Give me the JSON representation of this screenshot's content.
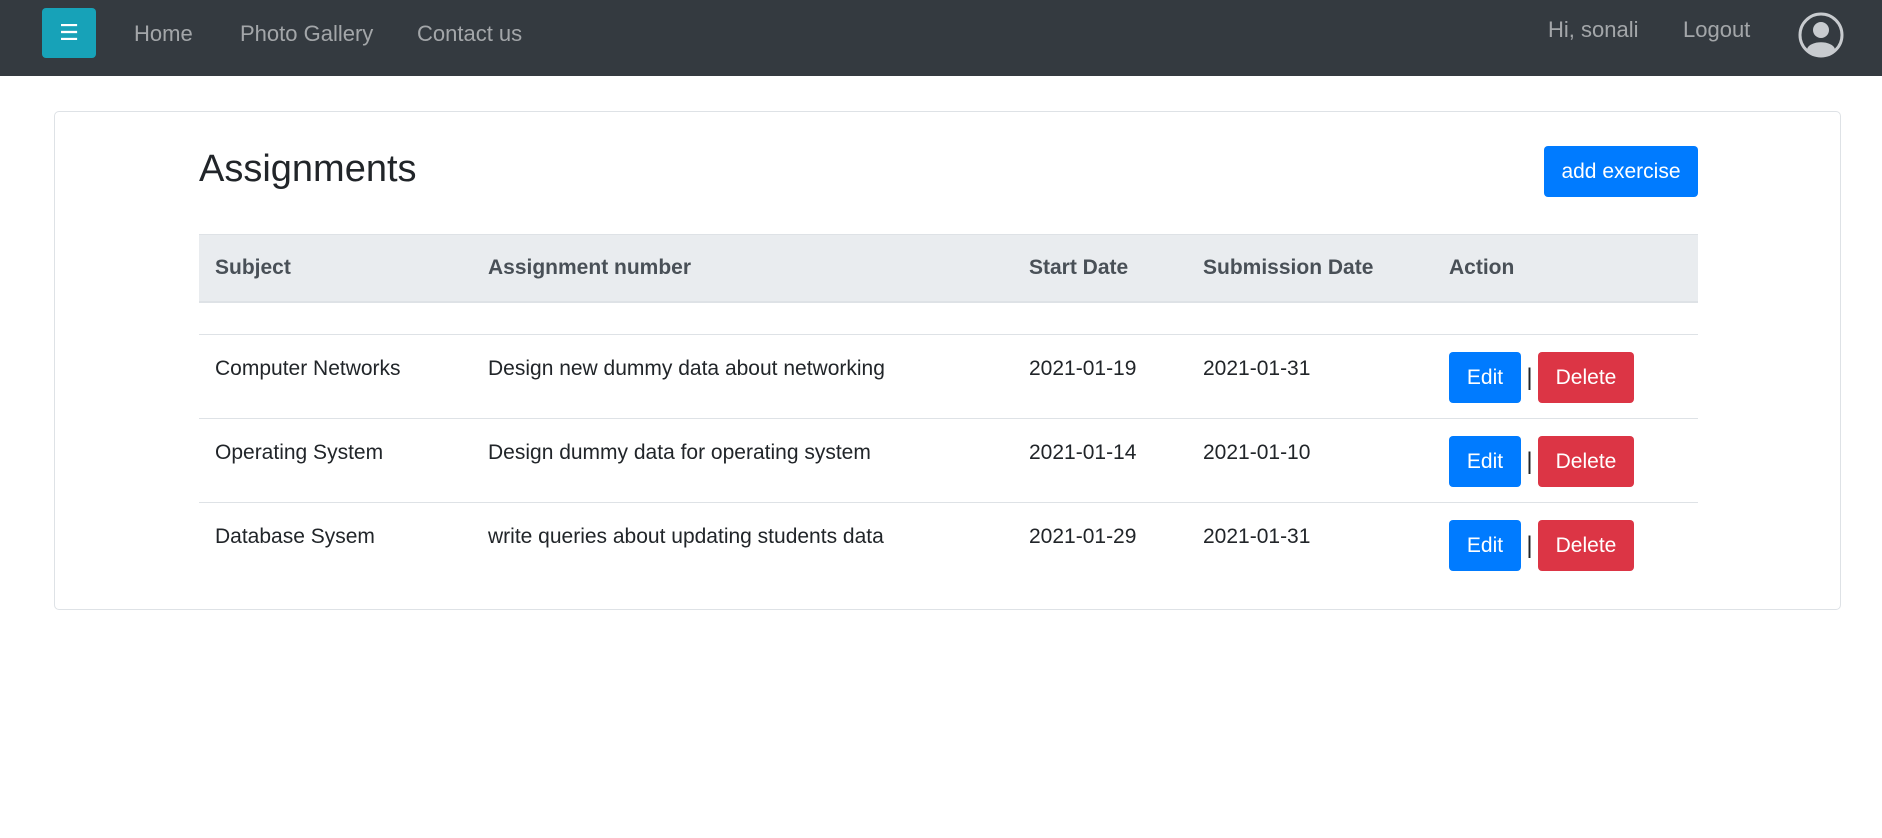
{
  "navbar": {
    "menu_icon": "☰",
    "links": [
      "Home",
      "Photo Gallery",
      "Contact us"
    ],
    "greeting": "Hi, sonali",
    "logout": "Logout",
    "avatar_icon": "user-circle-icon",
    "background": "#343a40",
    "toggle_color": "#17a2b8"
  },
  "main": {
    "title": "Assignments",
    "add_button": "add exercise"
  },
  "table": {
    "headers": [
      "Subject",
      "Assignment number",
      "Start Date",
      "Submission Date",
      "Action"
    ],
    "rows": [
      {
        "subject": "Computer Networks",
        "assignment": "Design new dummy data about networking",
        "start": "2021-01-19",
        "submission": "2021-01-31"
      },
      {
        "subject": "Operating System",
        "assignment": "Design dummy data for operating system",
        "start": "2021-01-14",
        "submission": "2021-01-10"
      },
      {
        "subject": "Database Sysem",
        "assignment": "write queries about updating students data",
        "start": "2021-01-29",
        "submission": "2021-01-31"
      }
    ],
    "edit_label": "Edit",
    "delete_label": "Delete",
    "separator": "|"
  },
  "colors": {
    "primary": "#007bff",
    "danger": "#dc3545",
    "header_bg": "#e9ecef"
  }
}
